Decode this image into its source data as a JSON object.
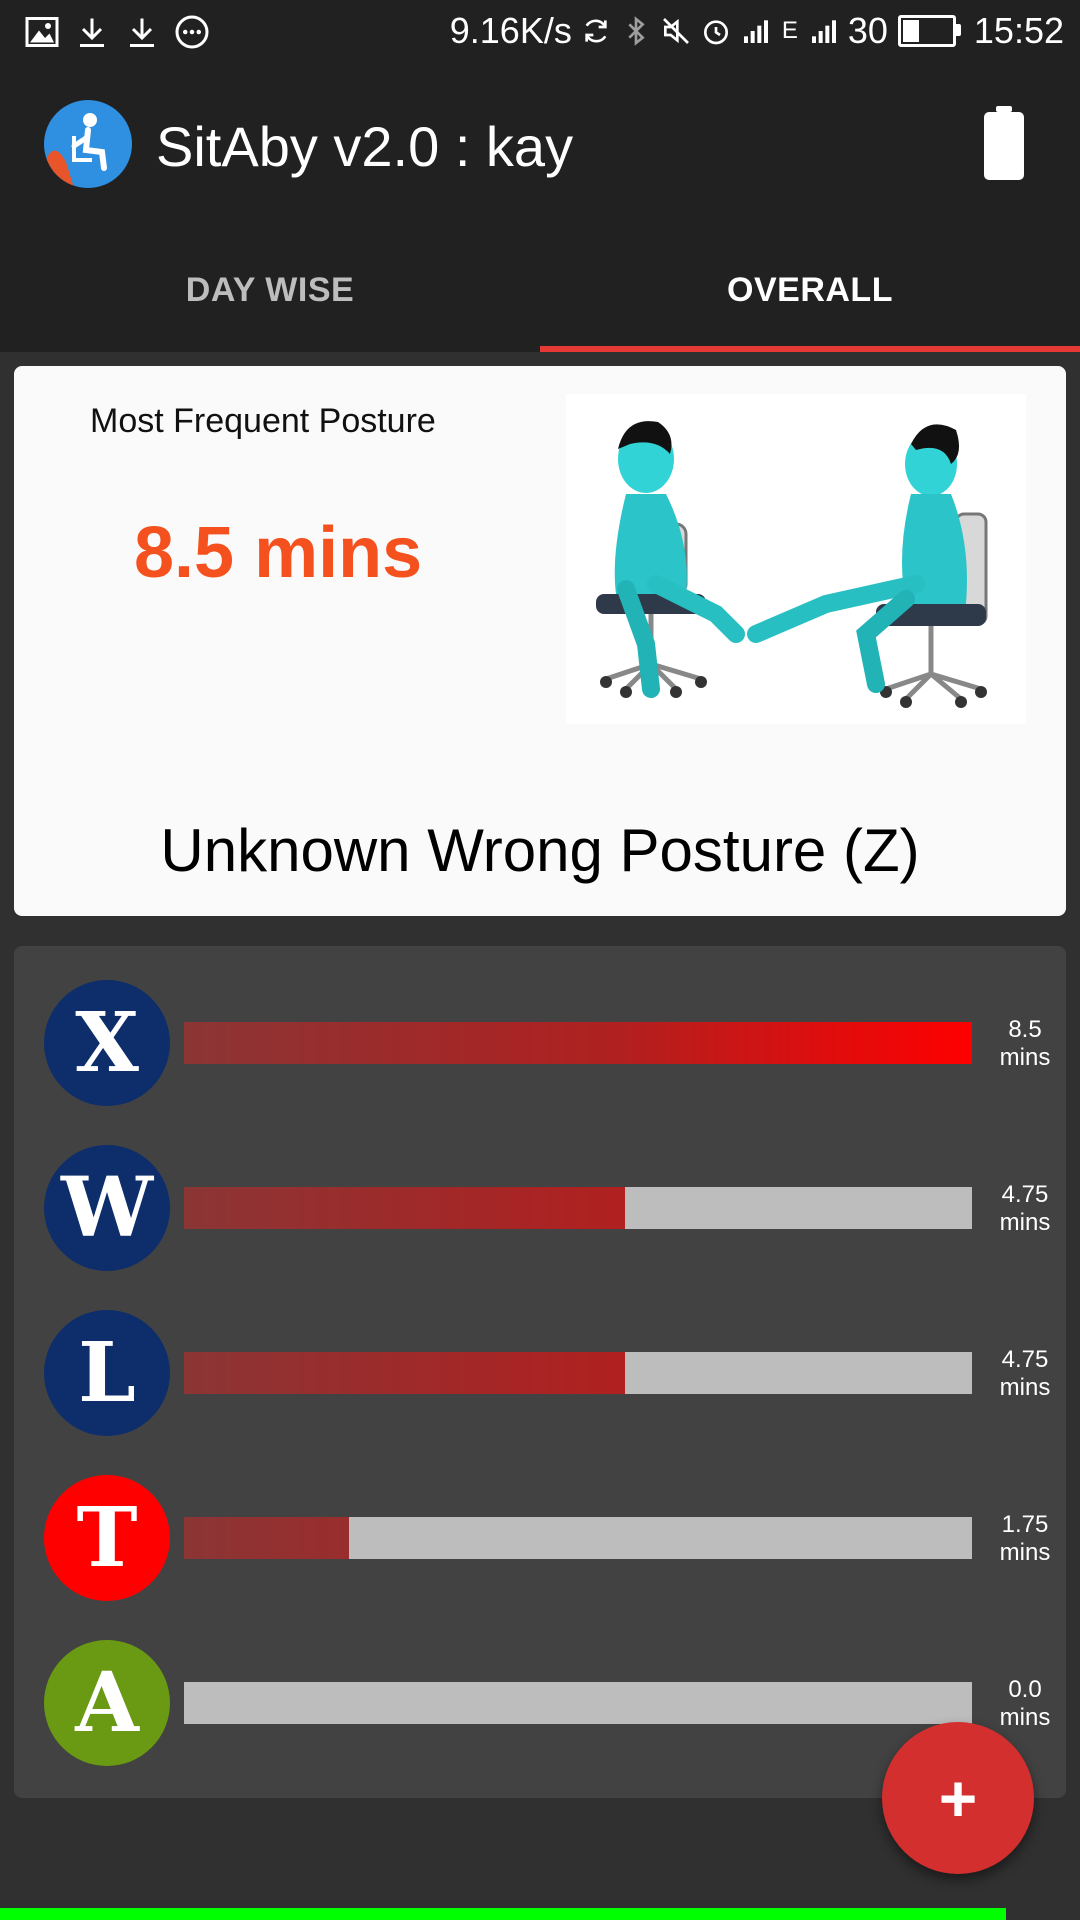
{
  "status_bar": {
    "network_speed": "9.16K/s",
    "network_type": "E",
    "battery_percent": "30",
    "time": "15:52"
  },
  "app_bar": {
    "title": "SitAby v2.0 : kay"
  },
  "tabs": [
    {
      "label": "DAY WISE",
      "selected": false
    },
    {
      "label": "OVERALL",
      "selected": true
    }
  ],
  "summary_card": {
    "label": "Most Frequent Posture",
    "value": "8.5 mins",
    "posture_name": "Unknown Wrong Posture (Z)"
  },
  "posture_bars": [
    {
      "letter": "X",
      "badge_color": "#0d2d6b",
      "value": "8.5",
      "unit": "mins",
      "fill_fraction": 1.0
    },
    {
      "letter": "W",
      "badge_color": "#0d2d6b",
      "value": "4.75",
      "unit": "mins",
      "fill_fraction": 0.56
    },
    {
      "letter": "L",
      "badge_color": "#0d2d6b",
      "value": "4.75",
      "unit": "mins",
      "fill_fraction": 0.56
    },
    {
      "letter": "T",
      "badge_color": "#ff0000",
      "value": "1.75",
      "unit": "mins",
      "fill_fraction": 0.21
    },
    {
      "letter": "A",
      "badge_color": "#6a9a13",
      "value": "0.0",
      "unit": "mins",
      "fill_fraction": 0.0
    }
  ],
  "fab": {
    "icon": "plus-icon",
    "label": "+"
  },
  "colors": {
    "accent": "#e53935",
    "highlight": "#f4511e",
    "bar_fill_start": "#8b3535",
    "bar_fill_end": "#ff0000",
    "bar_track": "#bdbdbd"
  }
}
